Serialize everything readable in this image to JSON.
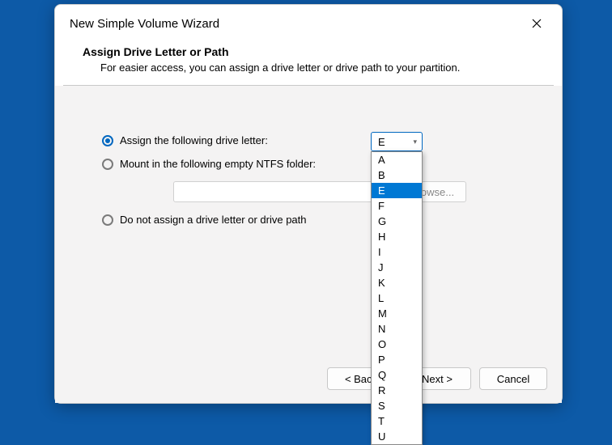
{
  "dialog": {
    "title": "New Simple Volume Wizard",
    "heading": "Assign Drive Letter or Path",
    "subheading": "For easier access, you can assign a drive letter or drive path to your partition."
  },
  "options": {
    "assign_letter": "Assign the following drive letter:",
    "mount_folder": "Mount in the following empty NTFS folder:",
    "no_letter": "Do not assign a drive letter or drive path",
    "browse": "Browse..."
  },
  "drive_select": {
    "selected": "E",
    "items": [
      "A",
      "B",
      "E",
      "F",
      "G",
      "H",
      "I",
      "J",
      "K",
      "L",
      "M",
      "N",
      "O",
      "P",
      "Q",
      "R",
      "S",
      "T",
      "U"
    ]
  },
  "footer": {
    "back": "< Back",
    "next": "Next >",
    "cancel": "Cancel"
  }
}
